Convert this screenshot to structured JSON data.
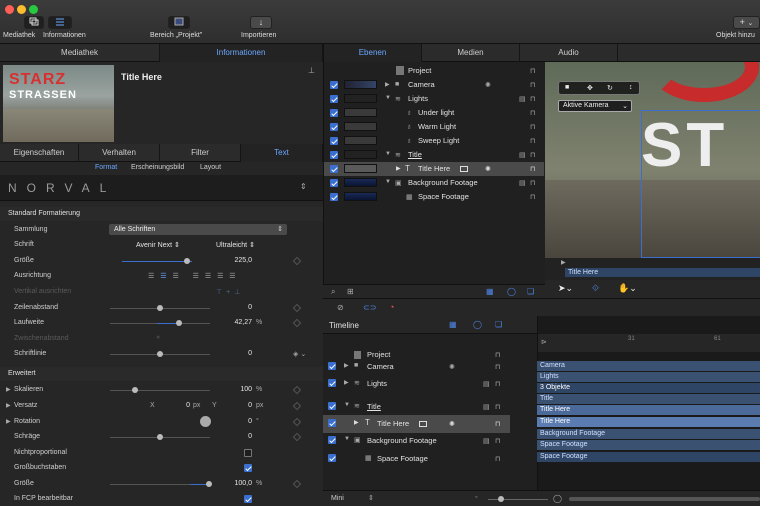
{
  "toolbar": {
    "mediathek_label": "Mediathek",
    "informationen_label": "Informationen",
    "bereich_label": "Bereich „Projekt\"",
    "importieren_label": "Importieren",
    "objekt_hinzu_label": "Objekt hinzu",
    "plus_symbol": "+",
    "chevron_symbol": "⌄",
    "import_symbol": "↓",
    "colors": {
      "close": "#fe5f57",
      "minimize": "#febc2e",
      "zoom": "#28c840"
    }
  },
  "left_tabs": {
    "mediathek": "Mediathek",
    "informationen": "Informationen"
  },
  "preview": {
    "title": "Title Here",
    "thumb_text1": "STARZ",
    "thumb_text2": "STRASSEN"
  },
  "inspector_tabs": {
    "eigenschaften": "Eigenschaften",
    "verhalten": "Verhalten",
    "filter": "Filter",
    "text": "Text"
  },
  "subtabs": {
    "format": "Format",
    "erscheinungsbild": "Erscheinungsbild",
    "layout": "Layout"
  },
  "font_preset": {
    "name": "NORVAL"
  },
  "standard": {
    "header": "Standard Formatierung",
    "sammlung_label": "Sammlung",
    "sammlung_value": "Alle Schriften",
    "schrift_label": "Schrift",
    "schrift_family": "Avenir Next",
    "schrift_style": "Ultraleicht",
    "groesse_label": "Größe",
    "groesse_value": "225,0",
    "ausrichtung_label": "Ausrichtung",
    "vertikal_label": "Vertikal ausrichten",
    "zeilenabstand_label": "Zeilenabstand",
    "zeilenabstand_value": "0",
    "laufweite_label": "Laufweite",
    "laufweite_value": "42,27",
    "laufweite_unit": "%",
    "zwischenabstand_label": "Zwischenabstand",
    "schriftlinie_label": "Schriftlinie",
    "schriftlinie_value": "0"
  },
  "advanced": {
    "header": "Erweitert",
    "skalieren_label": "Skalieren",
    "skalieren_value": "100",
    "skalieren_unit": "%",
    "versatz_label": "Versatz",
    "versatz_x_label": "X",
    "versatz_x_value": "0",
    "versatz_x_unit": "px",
    "versatz_y_label": "Y",
    "versatz_y_value": "0",
    "versatz_y_unit": "px",
    "rotation_label": "Rotation",
    "rotation_value": "0",
    "rotation_unit": "°",
    "schraege_label": "Schräge",
    "schraege_value": "0",
    "nichtproportional_label": "Nichtproportional",
    "grossbuchstaben_label": "Großbuchstaben",
    "groesse_label": "Größe",
    "groesse_value": "100,0",
    "groesse_unit": "%",
    "fcp_label": "In FCP bearbeitbar"
  },
  "right_tabs": {
    "ebenen": "Ebenen",
    "medien": "Medien",
    "audio": "Audio"
  },
  "layers": [
    {
      "name": "Project"
    },
    {
      "name": "Camera"
    },
    {
      "name": "Lights"
    },
    {
      "name": "Under light"
    },
    {
      "name": "Warm Light"
    },
    {
      "name": "Sweep Light"
    },
    {
      "name": "Title"
    },
    {
      "name": "Title Here"
    },
    {
      "name": "Background Footage"
    },
    {
      "name": "Space Footage"
    }
  ],
  "canvas": {
    "camera_select": "Aktive Kamera",
    "clip_label": "Title Here",
    "big_text": "ST"
  },
  "timeline": {
    "header": "Timeline",
    "ruler_marks": [
      "31",
      "61"
    ],
    "rows": [
      "Project",
      "Camera",
      "Lights",
      "Title",
      "Title Here",
      "Background Footage",
      "Space Footage"
    ],
    "bars": [
      "Camera",
      "Lights",
      "3 Objekte",
      "Title",
      "Title Here",
      "Title Here",
      "Background Footage",
      "Space Footage",
      "Space Footage"
    ],
    "mini_label": "Mini"
  },
  "accent": "#6aa7ff"
}
